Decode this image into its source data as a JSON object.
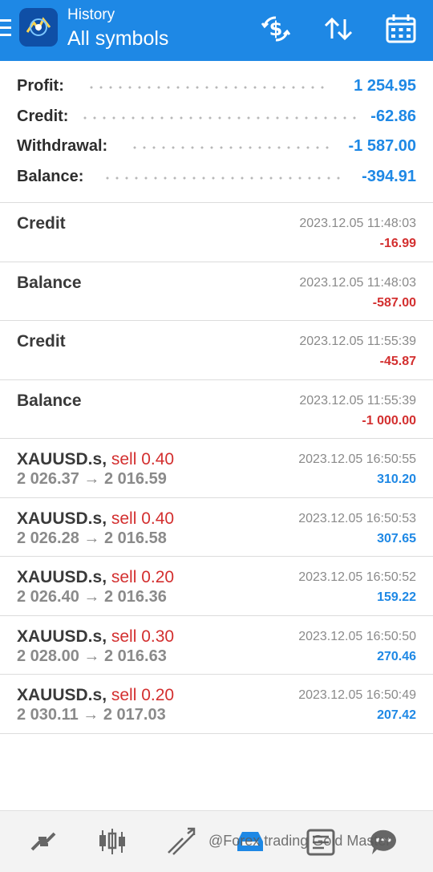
{
  "header": {
    "subtitle": "History",
    "title": "All symbols",
    "icons": [
      "menu-icon",
      "app-logo",
      "currency-exchange-icon",
      "sort-icon",
      "calendar-icon"
    ]
  },
  "summary": [
    {
      "label": "Profit:",
      "value": "1 254.95"
    },
    {
      "label": "Credit:",
      "value": "-62.86"
    },
    {
      "label": "Withdrawal:",
      "value": "-1 587.00"
    },
    {
      "label": "Balance:",
      "value": "-394.91"
    }
  ],
  "rows": [
    {
      "name": "Credit",
      "side": "",
      "prices": "",
      "time": "2023.12.05 11:48:03",
      "amount": "-16.99",
      "amount_color": "#d32f2f"
    },
    {
      "name": "Balance",
      "side": "",
      "prices": "",
      "time": "2023.12.05 11:48:03",
      "amount": "-587.00",
      "amount_color": "#d32f2f"
    },
    {
      "name": "Credit",
      "side": "",
      "prices": "",
      "time": "2023.12.05 11:55:39",
      "amount": "-45.87",
      "amount_color": "#d32f2f"
    },
    {
      "name": "Balance",
      "side": "",
      "prices": "",
      "time": "2023.12.05 11:55:39",
      "amount": "-1 000.00",
      "amount_color": "#d32f2f"
    },
    {
      "name": "XAUUSD.s,",
      "side": "sell 0.40",
      "prices": "2 026.37 → 2 016.59",
      "time": "2023.12.05 16:50:55",
      "amount": "310.20",
      "amount_color": "#1e88e5"
    },
    {
      "name": "XAUUSD.s,",
      "side": "sell 0.40",
      "prices": "2 026.28 → 2 016.58",
      "time": "2023.12.05 16:50:53",
      "amount": "307.65",
      "amount_color": "#1e88e5"
    },
    {
      "name": "XAUUSD.s,",
      "side": "sell 0.20",
      "prices": "2 026.40 → 2 016.36",
      "time": "2023.12.05 16:50:52",
      "amount": "159.22",
      "amount_color": "#1e88e5"
    },
    {
      "name": "XAUUSD.s,",
      "side": "sell 0.30",
      "prices": "2 028.00 → 2 016.63",
      "time": "2023.12.05 16:50:50",
      "amount": "270.46",
      "amount_color": "#1e88e5"
    },
    {
      "name": "XAUUSD.s,",
      "side": "sell 0.20",
      "prices": "2 030.11 → 2 017.03",
      "time": "2023.12.05 16:50:49",
      "amount": "207.42",
      "amount_color": "#1e88e5"
    }
  ],
  "bottom_nav": [
    "quotes-icon",
    "chart-icon",
    "trade-icon",
    "history-icon",
    "news-icon",
    "chat-icon"
  ],
  "watermark": "@Forex trading Gold Master",
  "colors": {
    "accent": "#1e88e5",
    "negative": "#d32f2f"
  }
}
